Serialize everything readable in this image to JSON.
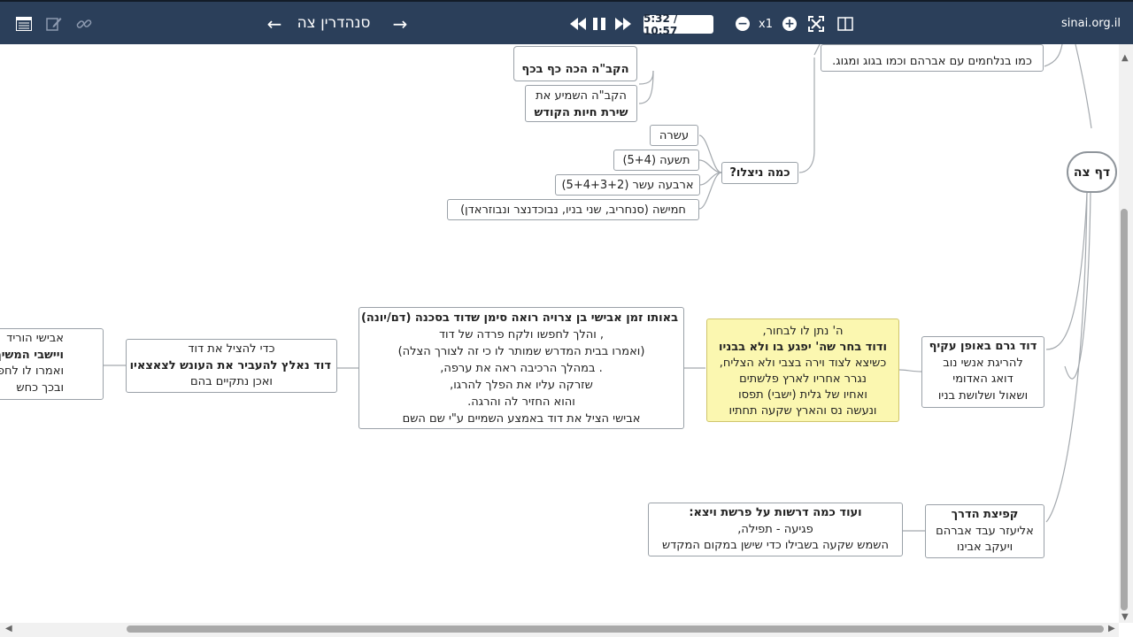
{
  "toolbar": {
    "outline_icon": "outline-icon",
    "edit_icon": "edit-icon",
    "link_icon": "link-icon",
    "prev_arrow": "←",
    "title": "סנהדרין צה",
    "next_arrow": "→",
    "rewind_icon": "⏪",
    "pause_icon": "⏸",
    "forward_icon": "⏩",
    "time": "5:32 / 10:57",
    "zoom_out": "−",
    "speed": "x1",
    "zoom_in": "+",
    "site": "sinai.org.il"
  },
  "map": {
    "root": "דף צה",
    "n_top_right": "כמו בנלחמים עם אברהם וכמו בגוג ומגוג.",
    "n_kaf": "הקב\"ה הכה כף בכף",
    "n_shira": [
      "הקב\"ה השמיע את",
      "שירת חיות הקודש"
    ],
    "q_kama": "כמה ניצלו?",
    "a1": "עשרה",
    "a2": "תשעה (5+4)",
    "a3": "ארבעה עשר (5+4+3+2)",
    "a4": "חמישה (סנחריב, שני בניו, נבוכדנצר ונבוזראדן)",
    "david": [
      "דוד גרם באופן עקיף",
      "להריגת אנשי נוב",
      "דואג האדומי",
      "ושאול  ושלושת בניו"
    ],
    "yellow": [
      "ה' נתן לו לבחור,",
      "ודוד  בחר שה' יפגע בו ולא בבניו",
      "כשיצא לצוד וירה בצבי ולא הצליח,",
      "נגרר אחריו לארץ פלשתים",
      "ואחיו  של גלית (ישבי) תפסו",
      "ונעשה נס והארץ שקעה תחתיו"
    ],
    "avishai": [
      "באותו זמן אבישי בן צרויה רואה סימן שדוד בסכנה (דם/יונה)",
      ", והלך לחפשו ולקח פרדה של דוד",
      "(ואמרו בבית המדרש שמותר לו כי זה לצורך הצלה)",
      ". במהלך הרכיבה ראה את ערפה,",
      "שזרקה עליו את הפלך להרגו,",
      "והוא החזיר לה והרגה.",
      "אבישי הציל את דוד באמצע השמיים ע\"י שם השם"
    ],
    "lehatzil": [
      "כדי להציל את דוד",
      "דוד נאלץ להעביר את העונש לצאצאיו",
      "ואכן נתקיים בהם"
    ],
    "left_cut": [
      "אבישי הוריד",
      "ויישבי המשיך",
      "ואמרו לו לחפש א",
      "ובכך כחש"
    ],
    "kfitza": [
      "קפיצת הדרך",
      "אליעזר עבד אברהם",
      "ויעקב  אבינו"
    ],
    "drashot": [
      "ועוד כמה דרשות על פרשת ויצא:",
      "פגיעה - תפילה,",
      "השמש שקעה בשבילו כדי שישן במקום המקדש"
    ]
  },
  "colors": {
    "toolbar": "#2b3f5a",
    "highlight_node": "#fbf7b0"
  }
}
